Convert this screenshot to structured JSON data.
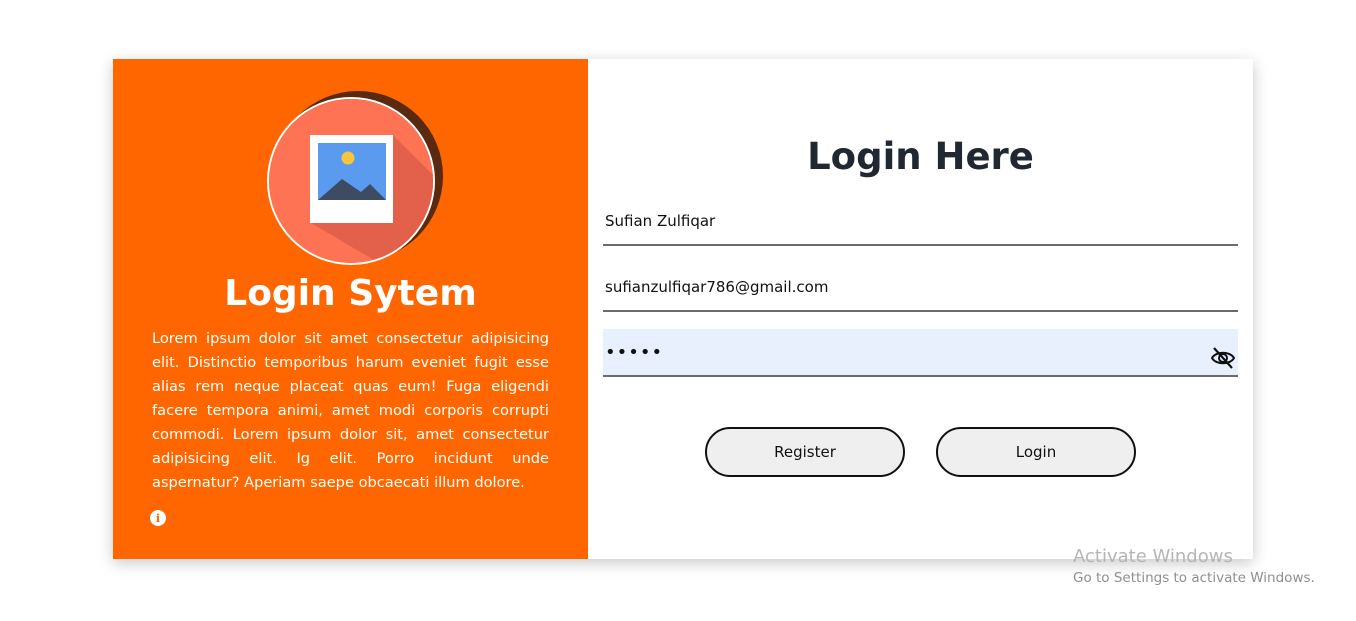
{
  "left_panel": {
    "title": "Login Sytem",
    "description": "Lorem ipsum dolor sit amet consectetur adipisicing elit. Distinctio temporibus harum eveniet fugit esse alias rem neque placeat quas eum! Fuga eligendi facere tempora animi, amet modi corporis corrupti commodi. Lorem ipsum dolor sit, amet consectetur adipisicing elit. Ig elit. Porro incidunt unde aspernatur? Aperiam saepe obcaecati illum dolore.",
    "image_icon": "image-placeholder-icon",
    "info_icon_glyph": "i",
    "background_color": "#ff6600"
  },
  "form": {
    "title": "Login Here",
    "name_value": "Sufian Zulfiqar",
    "email_value": "sufianzulfiqar786@gmail.com",
    "password_value": "•••••",
    "password_toggle_icon": "eye-slash-icon",
    "register_label": "Register",
    "login_label": "Login"
  },
  "watermark": {
    "title": "Activate Windows",
    "subtitle": "Go to Settings to activate Windows."
  }
}
